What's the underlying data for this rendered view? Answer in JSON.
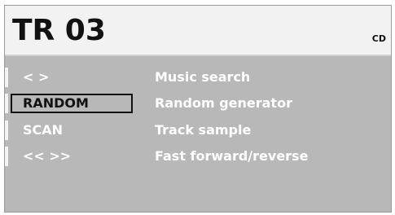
{
  "header": {
    "track": "TR 03",
    "source": "CD"
  },
  "menu": [
    {
      "key": "< >",
      "description": "Music search"
    },
    {
      "key": "RANDOM",
      "description": "Random generator"
    },
    {
      "key": "SCAN",
      "description": "Track sample"
    },
    {
      "key": "<< >>",
      "description": "Fast forward/reverse"
    }
  ]
}
